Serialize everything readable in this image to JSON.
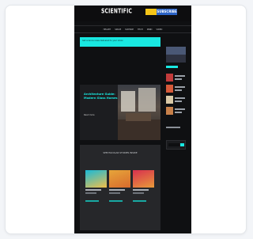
{
  "site": {
    "logo": "SCIENTIFIC",
    "promo_label": "SUBSCRIBE",
    "nav": [
      "HEALTH",
      "SPACE",
      "SCIENCE",
      "TECH",
      "MIND",
      "VIDEO"
    ],
    "banner_text": "Get science news delivered to your inbox",
    "hero": {
      "title": "Architecture Guide: Modern Glass Homes",
      "more": "Read more"
    },
    "episodes": {
      "title": "SPECTACULAR STORIES INSIDE"
    }
  },
  "colors": {
    "accent": "#19e8e1",
    "page_bg": "#0f1012",
    "promo_yellow": "#f5c518",
    "promo_blue": "#2b63c6"
  },
  "episode_covers": [
    "#18b9d8",
    "#e6a53a",
    "#d8304f"
  ],
  "sidebar_thumbs": [
    "#c23b3b",
    "#d65a3a",
    "#d9c9a7",
    "#c7804a"
  ]
}
